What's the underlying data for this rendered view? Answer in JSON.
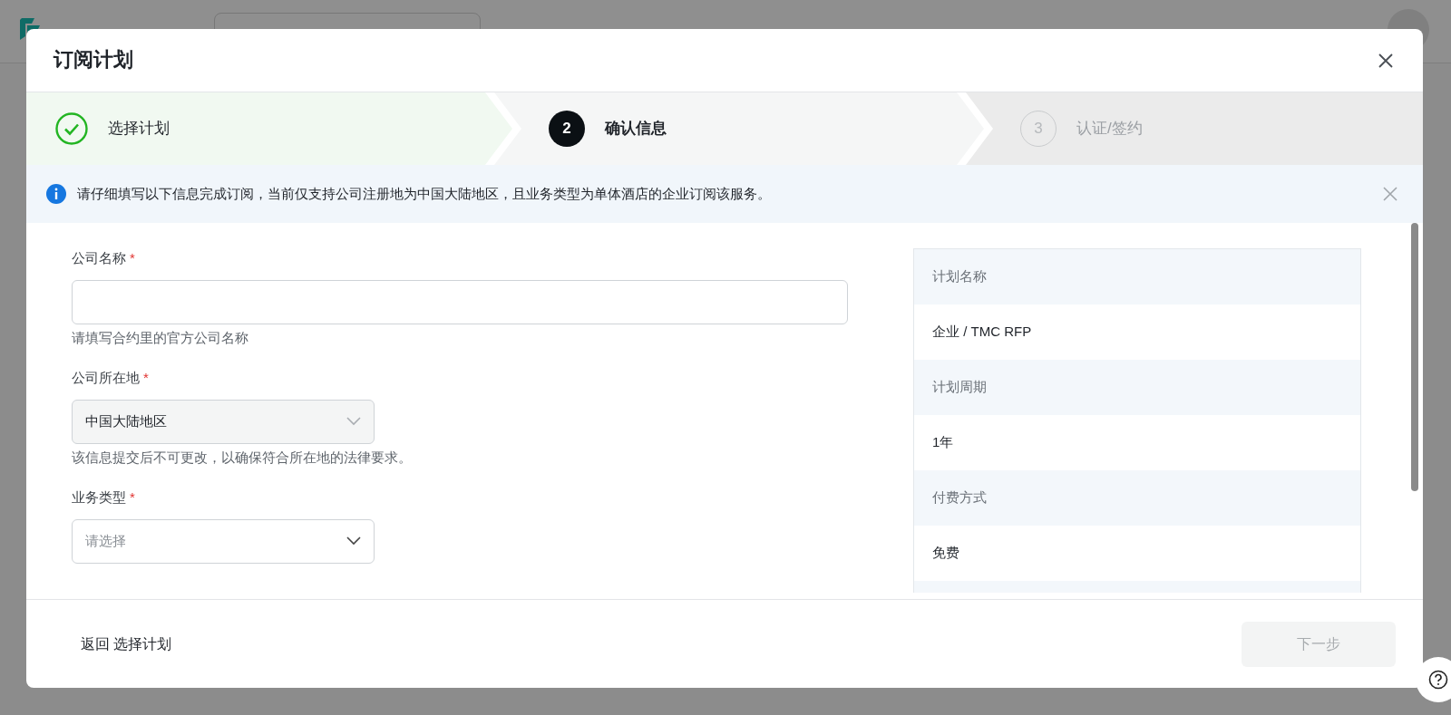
{
  "dialog": {
    "title": "订阅计划",
    "steps": [
      {
        "label": "选择计划",
        "completed": true,
        "selected": false
      },
      {
        "label": "确认信息",
        "number": "2",
        "completed": false,
        "selected": true
      },
      {
        "label": "认证/签约",
        "number": "3",
        "completed": false,
        "selected": false
      }
    ],
    "alert": {
      "text": "请仔细填写以下信息完成订阅，当前仅支持公司注册地为中国大陆地区，且业务类型为单体酒店的企业订阅该服务。"
    },
    "fields": [
      {
        "kind": "text",
        "label": "公司名称",
        "required_mark": "*",
        "help": "请填写合约里的官方公司名称"
      },
      {
        "kind": "select",
        "label": "公司所在地",
        "required_mark": "*",
        "value": "中国大陆地区",
        "disabled": true,
        "help": "该信息提交后不可更改，以确保符合所在地的法律要求。"
      },
      {
        "kind": "select",
        "label": "业务类型",
        "required_mark": "*",
        "placeholder": "请选择",
        "disabled": false
      }
    ],
    "summary": [
      {
        "label": "计划名称",
        "value": "企业 / TMC RFP"
      },
      {
        "label": "计划周期",
        "value": "1年"
      },
      {
        "label": "付费方式",
        "value": "免费"
      }
    ],
    "back_link": "返回 选择计划",
    "next_button": {
      "label": "下一步",
      "disabled": true
    }
  }
}
